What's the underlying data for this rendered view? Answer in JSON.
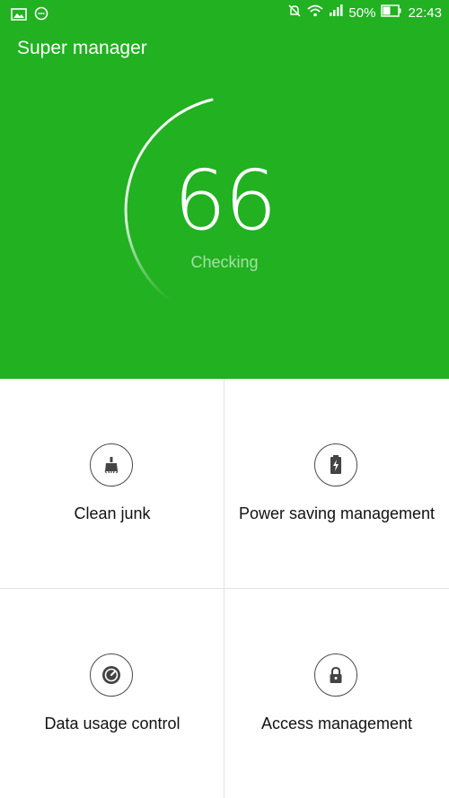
{
  "status_bar": {
    "battery_percent": "50%",
    "time": "22:43",
    "icons": [
      "gallery-icon",
      "chat-icon",
      "mute-icon",
      "wifi-icon",
      "signal-icon",
      "battery-icon"
    ]
  },
  "header": {
    "title": "Super manager",
    "score": "66",
    "status": "Checking",
    "colors": {
      "background": "#21b121",
      "text": "#ffffff"
    }
  },
  "tiles": [
    {
      "label": "Clean junk",
      "icon": "broom-icon"
    },
    {
      "label": "Power saving management",
      "icon": "battery-charge-icon"
    },
    {
      "label": "Data usage control",
      "icon": "gauge-icon"
    },
    {
      "label": "Access management",
      "icon": "lock-icon"
    }
  ]
}
